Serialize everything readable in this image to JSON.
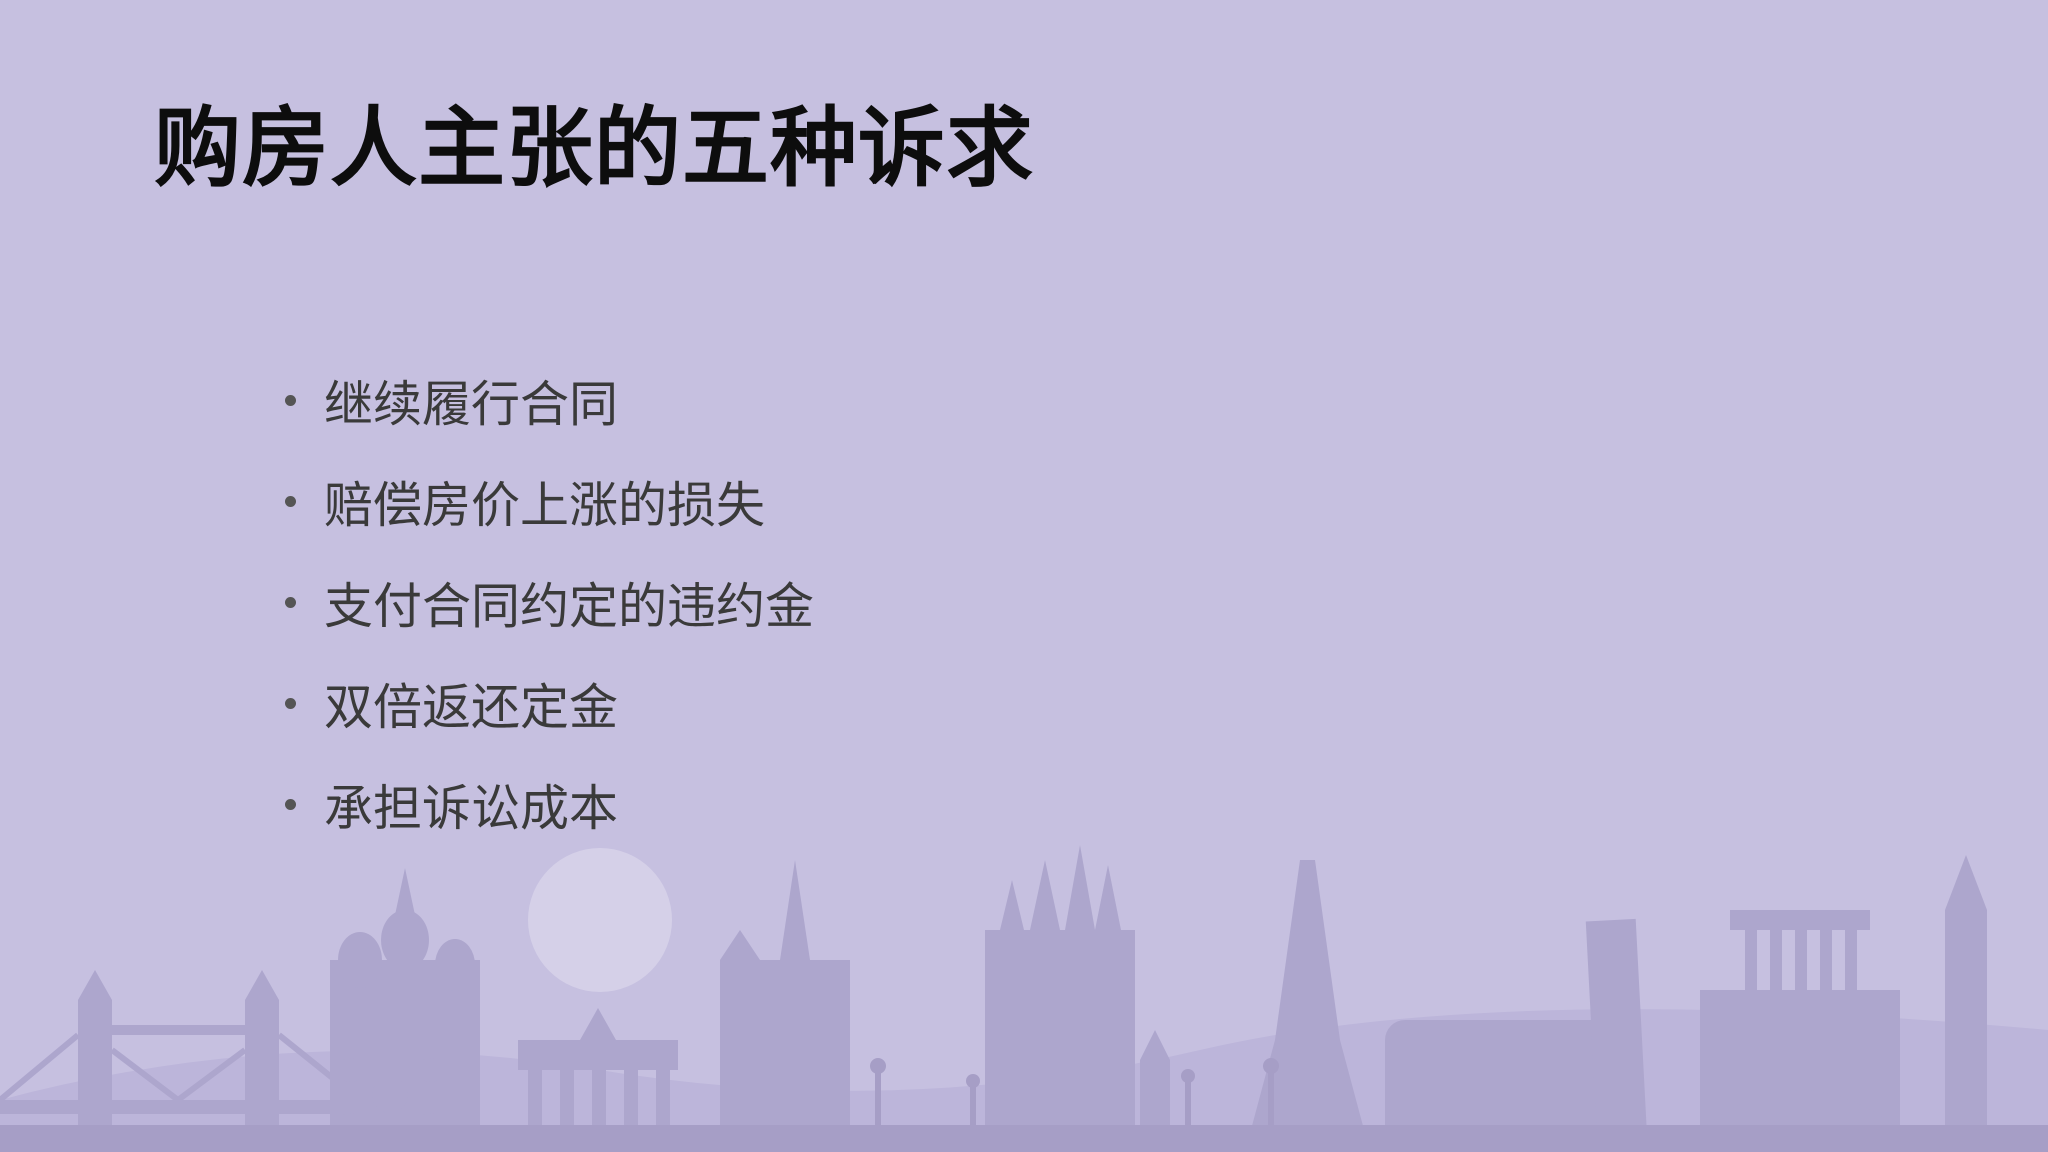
{
  "slide": {
    "title": "购房人主张的五种诉求",
    "bullets": [
      "继续履行合同",
      "赔偿房价上涨的损失",
      "支付合同约定的违约金",
      "双倍返还定金",
      "承担诉讼成本"
    ]
  },
  "colors": {
    "background": "#c6c0e0",
    "skyline_light": "#b7b0d6",
    "skyline_dark": "#a69ec6",
    "moon": "#d5d0e8"
  }
}
